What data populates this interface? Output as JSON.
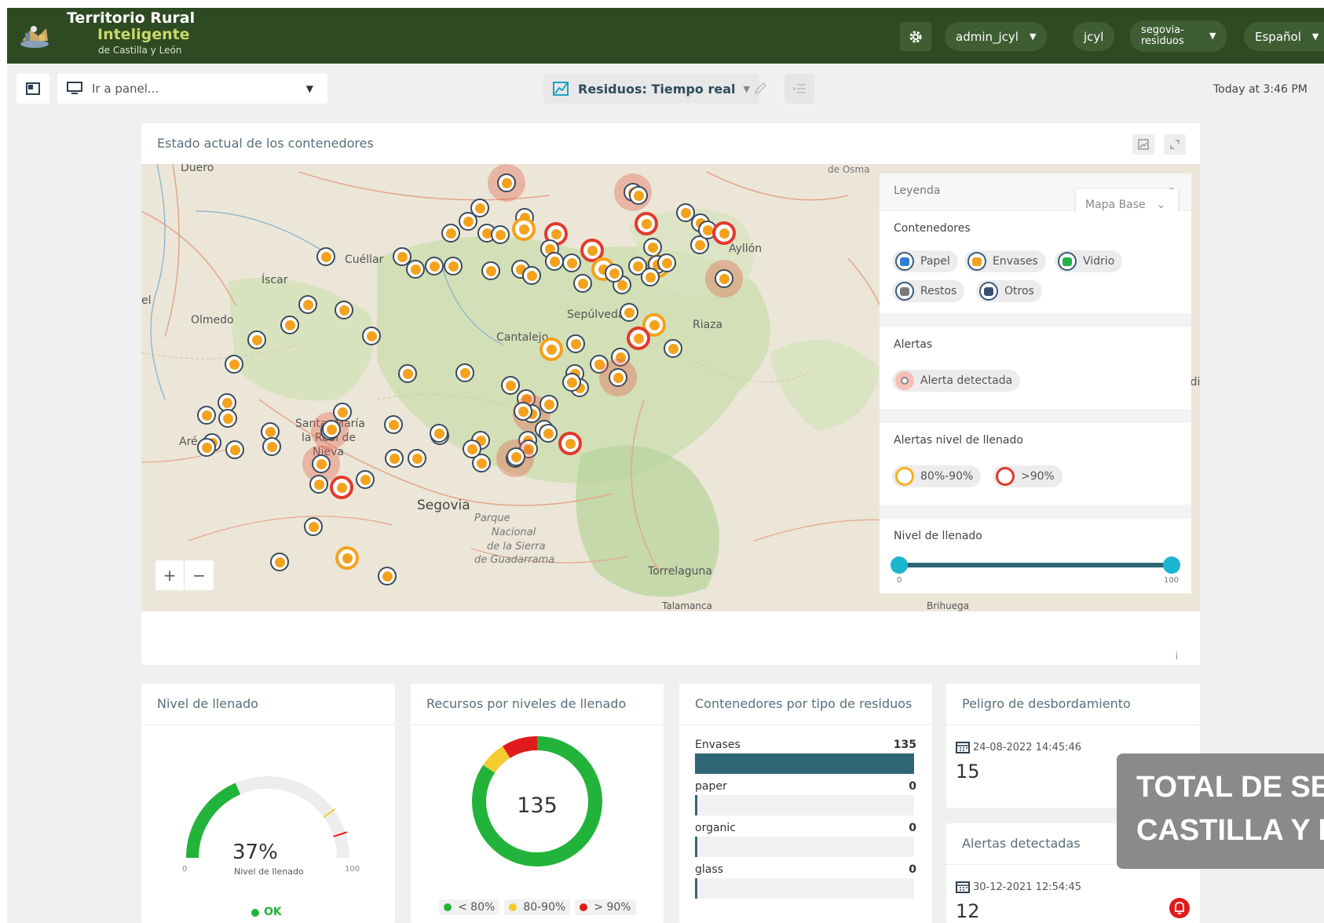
{
  "brand": {
    "line1": "Territorio Rural",
    "line2": "Inteligente",
    "line3": "de Castilla y León"
  },
  "topbar": {
    "gear_icon": "gear-icon",
    "user": "admin_jcyl",
    "org": "jcyl",
    "project": [
      "segovia-",
      "residuos"
    ],
    "language": "Español"
  },
  "toolbar": {
    "panel_placeholder": "Ir a panel...",
    "dashboard_title": "Residuos: Tiempo real",
    "time": "Today at 3:46 PM"
  },
  "map_panel": {
    "title": "Estado actual de los contenedores",
    "info": "i",
    "zoom_in": "+",
    "zoom_out": "−",
    "places": [
      "Duero",
      "Cuéllar",
      "Íscar",
      "Olmedo",
      "Sepúlveda",
      "Cantalejo",
      "Riaza",
      "Ayllón",
      "Santa María la Real de Nieva",
      "Arévalo",
      "Segovia",
      "Torrelaguna",
      "Talamanca",
      "Brihuega"
    ],
    "place_labels": {
      "duero": "Duero",
      "cuellar": "Cuéllar",
      "iscar": "Íscar",
      "olmedo": "Olmedo",
      "sepulveda": "Sepúlveda",
      "cantalejo": "Cantalejo",
      "riaza": "Riaza",
      "ayllon": "Ayllón",
      "santa1": "Santa",
      "santa2": "María",
      "santa3": "la Real de",
      "santa4": "Nieva",
      "arevalo": "Aré",
      "el": "el",
      "segovia": "Segovia",
      "park1": "Parque",
      "park2": "Nacional",
      "park3": "de la Sierra",
      "park4": "de Guadarrama",
      "torrelaguna": "Torrelaguna",
      "talamanca": "Talamanca",
      "brihuega": "Brihuega",
      "edge": "edi",
      "ayllon_top": "de Osma"
    },
    "legend": {
      "header": "Leyenda",
      "basemap": "Mapa Base",
      "containers_title": "Contenedores",
      "containers": [
        {
          "label": "Papel",
          "color": "#2f7fd0"
        },
        {
          "label": "Envases",
          "color": "#f3a21d"
        },
        {
          "label": "Vidrio",
          "color": "#22b04b"
        },
        {
          "label": "Restos",
          "color": "#7a7a7a"
        },
        {
          "label": "Otros",
          "color": "#3a5070"
        }
      ],
      "alerts_title": "Alertas",
      "alert_label": "Alerta detectada",
      "fill_alerts_title": "Alertas nivel de llenado",
      "fill_alerts": [
        {
          "label": "80%-90%",
          "color": "#f3b21d"
        },
        {
          "label": ">90%",
          "color": "#e23a2d"
        }
      ],
      "fill_title": "Nivel de llenado",
      "fill_min": "0",
      "fill_max": "100",
      "fill_range": [
        0,
        100
      ]
    }
  },
  "gauge_panel": {
    "title": "Nivel de llenado",
    "value": 37,
    "value_text": "37%",
    "caption": "Nivel de llenado",
    "min": "0",
    "max": "100",
    "status": "OK"
  },
  "donut_panel": {
    "title": "Recursos por niveles de llenado",
    "total": "135",
    "legend": [
      {
        "label": "< 80%",
        "color": "#22b43a"
      },
      {
        "label": "80-90%",
        "color": "#f2cc30"
      },
      {
        "label": "> 90%",
        "color": "#e01b1b"
      }
    ]
  },
  "bars_panel": {
    "title": "Contenedores por tipo de residuos",
    "bars": [
      {
        "label": "Envases",
        "value": "135",
        "fraction": 1.0
      },
      {
        "label": "paper",
        "value": "0",
        "fraction": 0
      },
      {
        "label": "organic",
        "value": "0",
        "fraction": 0
      },
      {
        "label": "glass",
        "value": "0",
        "fraction": 0
      }
    ]
  },
  "overflow_panel": {
    "title": "Peligro de desbordamiento",
    "date": "24-08-2022 14:45:46",
    "value": "15"
  },
  "alerts_panel": {
    "title": "Alertas detectadas",
    "date": "30-12-2021 12:54:45",
    "value": "12"
  },
  "chart_data": [
    {
      "type": "pie",
      "title": "Recursos por niveles de llenado",
      "categories": [
        "< 80%",
        "80-90%",
        "> 90%"
      ],
      "values": [
        114,
        9,
        12
      ],
      "total": 135
    },
    {
      "type": "bar",
      "title": "Contenedores por tipo de residuos",
      "categories": [
        "Envases",
        "paper",
        "organic",
        "glass"
      ],
      "values": [
        135,
        0,
        0,
        0
      ]
    }
  ],
  "overlay": {
    "line1": "TOTAL DE SE",
    "line2": "CASTILLA Y L"
  }
}
